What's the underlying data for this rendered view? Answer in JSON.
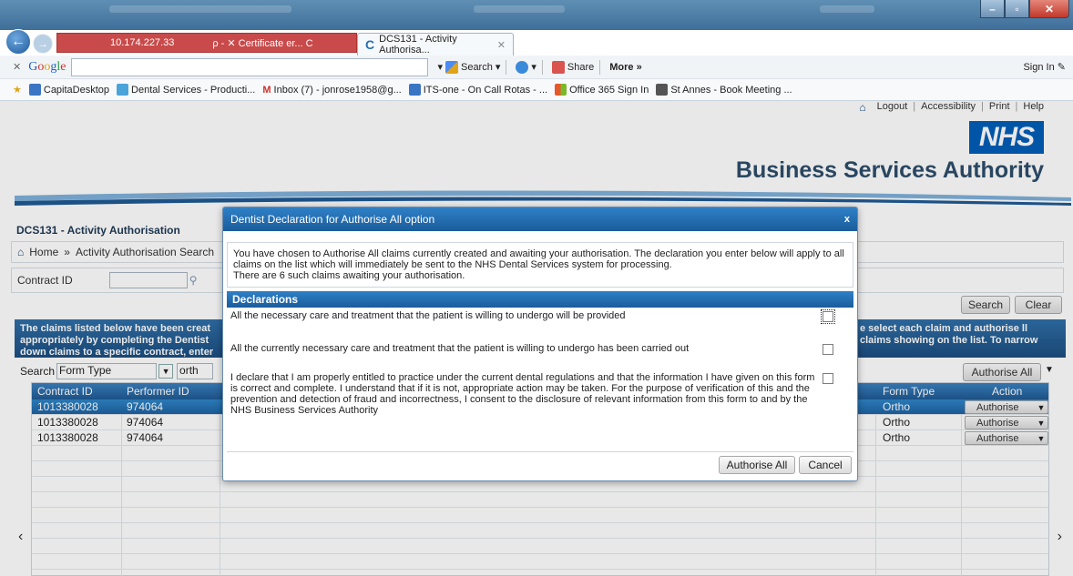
{
  "browser": {
    "address_url": "10.174.227.33",
    "address_controls": "ρ - ✕ Certificate er... C",
    "tabs": [
      {
        "label": "DCS131 - Activity Authorisa...",
        "active": true
      }
    ],
    "google_toolbar": {
      "logo": "Google",
      "search_label": "Search",
      "share_label": "Share",
      "more_label": "More »",
      "signin_label": "Sign In"
    },
    "favorites": [
      {
        "label": "CapitaDesktop"
      },
      {
        "label": "Dental Services - Producti..."
      },
      {
        "label": "Inbox (7) - jonrose1958@g..."
      },
      {
        "label": "ITS-one - On Call Rotas - ..."
      },
      {
        "label": "Office 365 Sign In"
      },
      {
        "label": "St Annes - Book Meeting ..."
      }
    ]
  },
  "header": {
    "links": [
      "Logout",
      "Accessibility",
      "Print",
      "Help"
    ],
    "nhs_logo": "NHS",
    "org_name": "Business Services Authority"
  },
  "page": {
    "title": "DCS131 - Activity Authorisation",
    "breadcrumb": {
      "home": "Home",
      "current": "Activity Authorisation Search"
    },
    "filter_label": "Contract ID",
    "search_button": "Search",
    "clear_button": "Clear",
    "info_text_left": "The claims listed below have been creat appropriately by completing the Dentist down claims to a specific contract, enter",
    "info_text_right": "e select each claim and authorise ll claims showing on the list. To narrow",
    "search_by_label": "Search",
    "search_by_value": "Form Type",
    "search_value": "orth",
    "authorise_all_button": "Authorise All"
  },
  "grid": {
    "columns": [
      "Contract ID",
      "Performer ID",
      "Form Type",
      "Action"
    ],
    "rows": [
      {
        "contract_id": "1013380028",
        "performer_id": "974064",
        "form_type": "Ortho",
        "action": "Authorise",
        "selected": true
      },
      {
        "contract_id": "1013380028",
        "performer_id": "974064",
        "form_type": "Ortho",
        "action": "Authorise",
        "selected": false
      },
      {
        "contract_id": "1013380028",
        "performer_id": "974064",
        "form_type": "Ortho",
        "action": "Authorise",
        "selected": false
      }
    ]
  },
  "modal": {
    "title": "Dentist Declaration for Authorise All option",
    "close_label": "x",
    "intro_line1": "You have chosen to Authorise All claims currently created and awaiting your authorisation. The declaration you enter below will apply to all claims on the list which will immediately be sent to the NHS Dental Services system for processing.",
    "intro_line2": "There are 6 such claims awaiting your authorisation.",
    "declarations_heading": "Declarations",
    "declarations": [
      {
        "text": "All the necessary care and treatment that the patient is willing to undergo will be provided",
        "checked": false
      },
      {
        "text": "All the currently necessary care and treatment that the patient is willing to undergo has been carried out",
        "checked": false
      },
      {
        "text": "I declare that I am properly entitled to practice under the current dental regulations and that the information I have given on this form is correct and complete. I understand that if it is not, appropriate action may be taken. For the purpose of verification of this and the prevention and detection of fraud and incorrectness, I consent to the disclosure of relevant information from this form to and by the NHS Business Services Authority",
        "checked": false
      }
    ],
    "authorise_all_button": "Authorise All",
    "cancel_button": "Cancel"
  },
  "colors": {
    "nhs_blue": "#005eb8",
    "header_blue": "#1f5a94",
    "selected_row": "#2f86c8"
  }
}
